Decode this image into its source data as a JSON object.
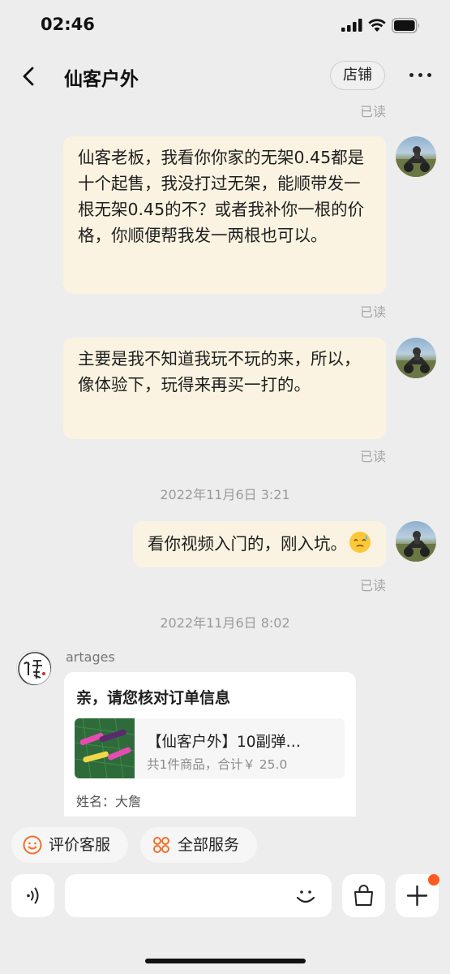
{
  "status_bar": {
    "time": "02:46"
  },
  "nav": {
    "title": "仙客户外",
    "shop_label": "店铺"
  },
  "messages": [
    {
      "read": "已读"
    },
    {
      "text": "仙客老板，我看你你家的无架0.45都是十个起售，我没打过无架，能顺带发一根无架0.45的不？或者我补你一根的价格，你顺便帮我发一两根也可以。",
      "read": "已读"
    },
    {
      "text": "主要是我不知道我玩不玩的来，所以，像体验下，玩得来再买一打的。",
      "read": "已读"
    },
    {
      "text": "看你视频入门的，刚入坑。",
      "read": "已读"
    }
  ],
  "time_dividers": [
    "2022年11月6日 3:21",
    "2022年11月6日 8:02"
  ],
  "incoming": {
    "sender": "artages",
    "avatar_text": "仙客户外",
    "order_card": {
      "heading": "亲，请您核对订单信息",
      "product_title": "【仙客户外】10副弹…",
      "product_summary": "共1件商品，合计￥ 25.0",
      "name_label": "姓名：",
      "name_value": "大詹"
    }
  },
  "quick_actions": {
    "rate": "评价客服",
    "all_services": "全部服务"
  },
  "input": {
    "placeholder": ""
  },
  "colors": {
    "accent": "#f2702a",
    "bubble": "#fbf3e1",
    "background": "#ededed",
    "badge": "#ff5a1f"
  }
}
